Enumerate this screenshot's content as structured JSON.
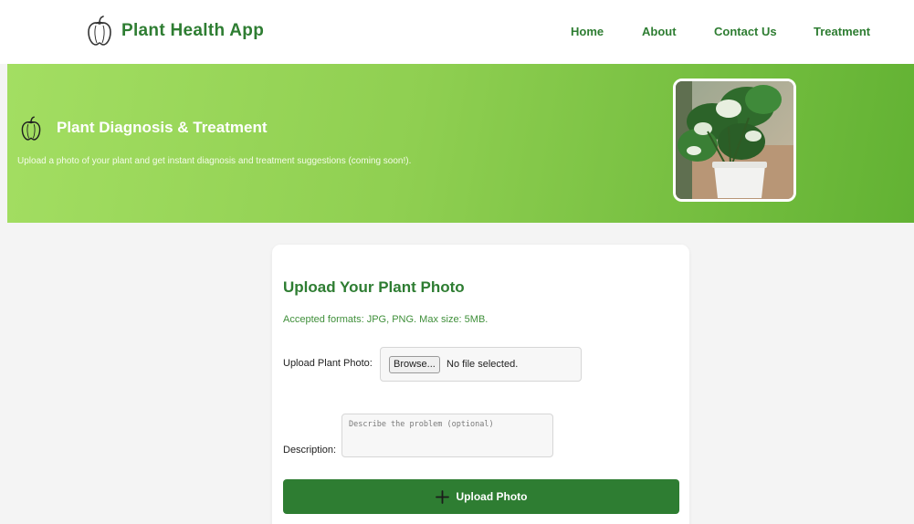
{
  "header": {
    "app_name": "Plant Health App",
    "logo_icon": "bell-pepper-icon",
    "nav": [
      {
        "label": "Home"
      },
      {
        "label": "About"
      },
      {
        "label": "Contact Us"
      },
      {
        "label": "Treatment"
      }
    ]
  },
  "hero": {
    "icon": "bell-pepper-icon",
    "title": "Plant Diagnosis & Treatment",
    "subtitle": "Upload a photo of your plant and get instant diagnosis and treatment suggestions (coming soon!).",
    "image": "potted-plant-photo"
  },
  "upload_card": {
    "title": "Upload Your Plant Photo",
    "formats_note": "Accepted formats: JPG, PNG. Max size: 5MB.",
    "photo_label": "Upload Plant Photo:",
    "browse_label": "Browse...",
    "no_file_text": "No file selected.",
    "description_label": "Description:",
    "description_placeholder": "Describe the problem (optional)",
    "submit_label": "Upload Photo",
    "submit_icon": "plus-icon"
  },
  "colors": {
    "brand_green": "#2e7d32",
    "hero_gradient_start": "#a3de62",
    "hero_gradient_end": "#62b233",
    "page_background": "#f4f4f4"
  }
}
